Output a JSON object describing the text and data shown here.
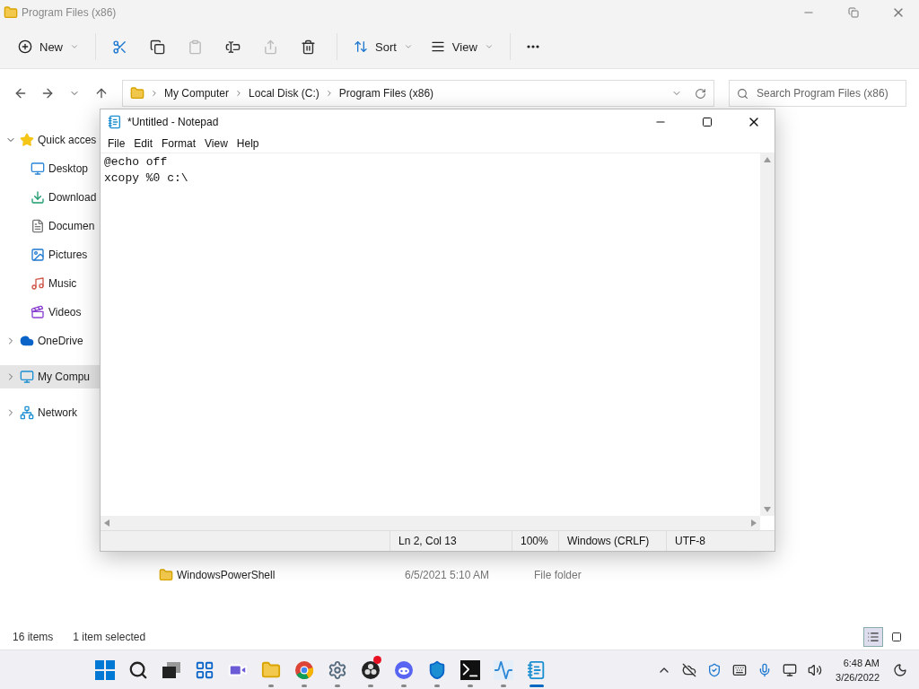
{
  "explorer": {
    "title": "Program Files (x86)",
    "toolbar": {
      "new_label": "New",
      "sort_label": "Sort",
      "view_label": "View",
      "actions": [
        {
          "disabled": false
        },
        {
          "disabled": false
        },
        {
          "disabled": true
        },
        {
          "disabled": false
        },
        {
          "disabled": true
        },
        {
          "disabled": false
        }
      ]
    },
    "breadcrumbs": [
      "My Computer",
      "Local Disk (C:)",
      "Program Files (x86)"
    ],
    "search": {
      "placeholder": "Search Program Files (x86)"
    },
    "sidebar": [
      {
        "label": "Quick acces",
        "expanded": true,
        "selected": false,
        "children": [
          {
            "label": "Desktop"
          },
          {
            "label": "Download"
          },
          {
            "label": "Documen"
          },
          {
            "label": "Pictures"
          },
          {
            "label": "Music"
          },
          {
            "label": "Videos"
          }
        ]
      },
      {
        "label": "OneDrive",
        "expanded": false,
        "selected": false
      },
      {
        "label": "My Compu",
        "expanded": false,
        "selected": true
      },
      {
        "label": "Network",
        "expanded": false,
        "selected": false
      }
    ],
    "rows": [
      {
        "name": "WindowsPowerShell",
        "date": "6/5/2021 5:10 AM",
        "type": "File folder"
      }
    ],
    "status": {
      "count": "16 items",
      "selection": "1 item selected"
    },
    "views": [
      {
        "selected": true
      },
      {
        "selected": false
      }
    ]
  },
  "notepad": {
    "title": "*Untitled - Notepad",
    "menu": [
      "File",
      "Edit",
      "Format",
      "View",
      "Help"
    ],
    "lines": [
      "@echo off",
      "xcopy %0 c:\\"
    ],
    "status": [
      "Ln 2, Col 13",
      "100%",
      "Windows (CRLF)",
      "UTF-8"
    ]
  },
  "taskbar": {
    "apps": [
      {
        "running": false,
        "active": false
      },
      {
        "running": false,
        "active": false
      },
      {
        "running": false,
        "active": false
      },
      {
        "running": false,
        "active": false
      },
      {
        "running": false,
        "active": false
      },
      {
        "running": true,
        "active": false
      },
      {
        "running": true,
        "active": false
      },
      {
        "running": true,
        "active": false
      },
      {
        "running": true,
        "active": false
      },
      {
        "running": true,
        "active": false
      },
      {
        "running": true,
        "active": false
      },
      {
        "running": true,
        "active": false
      },
      {
        "running": true,
        "active": false
      },
      {
        "running": true,
        "active": true
      }
    ],
    "time": "6:48 AM",
    "date": "3/26/2022"
  }
}
